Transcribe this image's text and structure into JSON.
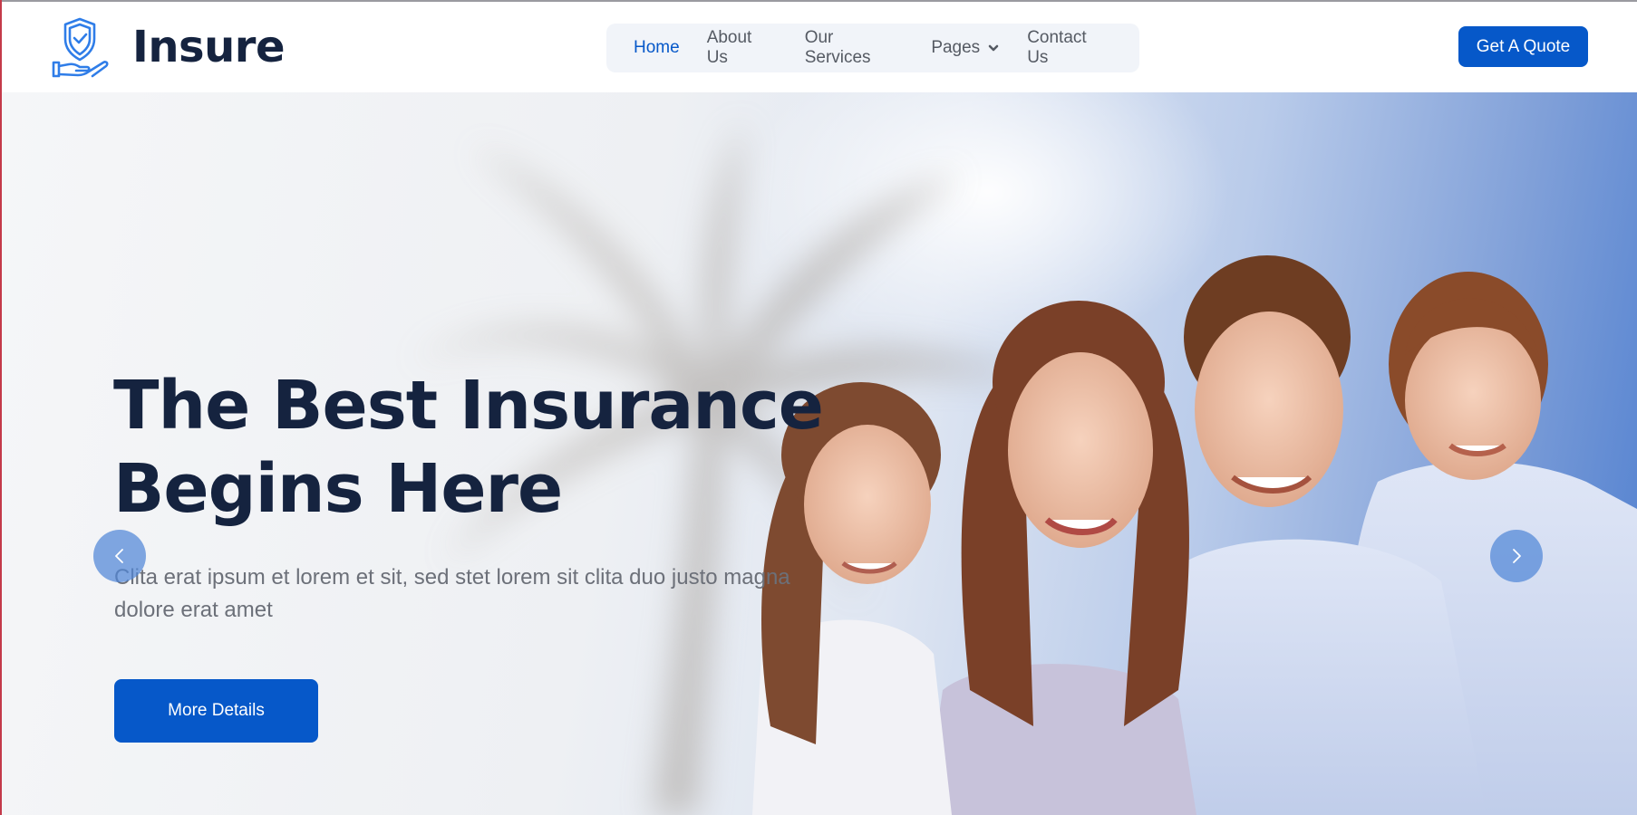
{
  "brand": {
    "name": "Insure",
    "logo_icon": "shield-hand-icon"
  },
  "nav": {
    "items": [
      {
        "label": "Home",
        "active": true
      },
      {
        "label": "About Us",
        "active": false
      },
      {
        "label": "Our Services",
        "active": false
      },
      {
        "label": "Pages",
        "active": false,
        "icon": "chevron-down-icon"
      },
      {
        "label": "Contact Us",
        "active": false
      }
    ],
    "cta_label": "Get A Quote"
  },
  "hero": {
    "title_line1": "The Best Insurance",
    "title_line2": "Begins Here",
    "subtitle": "Clita erat ipsum et lorem et sit, sed stet lorem sit clita duo justo magna dolore erat amet",
    "button_label": "More Details",
    "prev_icon": "chevron-left-icon",
    "next_icon": "chevron-right-icon",
    "image": "smiling-family-photo"
  },
  "colors": {
    "primary": "#0658c9",
    "heading": "#15233f",
    "nav_text": "#555a63",
    "nav_bg": "#f1f4f9",
    "body_text": "#6c7079"
  }
}
